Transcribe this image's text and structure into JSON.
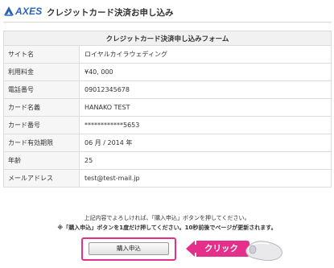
{
  "header": {
    "logo_text": "AXES",
    "page_title": "クレジットカード決済お申し込み"
  },
  "form": {
    "heading": "クレジットカード決済申し込みフォーム",
    "rows": [
      {
        "label": "サイト名",
        "value": "ロイヤルカイラウェディング"
      },
      {
        "label": "利用料金",
        "value": "¥40, 000"
      },
      {
        "label": "電話番号",
        "value": "09012345678"
      },
      {
        "label": "カード名義",
        "value": "HANAKO TEST"
      },
      {
        "label": "カード番号",
        "value": "************5653"
      },
      {
        "label": "カード有効期限",
        "value": "06 月 / 2014 年"
      },
      {
        "label": "年齢",
        "value": "25"
      },
      {
        "label": "メールアドレス",
        "value": "test@test-mail.jp"
      }
    ]
  },
  "notices": {
    "line1": "上記内容でよろしければ、「購入申込」ボタンを押してください。",
    "line2": "※「購入申込」ボタンを1度だけ押してください。10秒前後でページが更新されます。"
  },
  "submit": {
    "label": "購入申込"
  },
  "callout": {
    "label": "クリック",
    "icon": "mouse-icon"
  },
  "colors": {
    "accent": "#e4308a",
    "logo_blue": "#2b63b3"
  }
}
